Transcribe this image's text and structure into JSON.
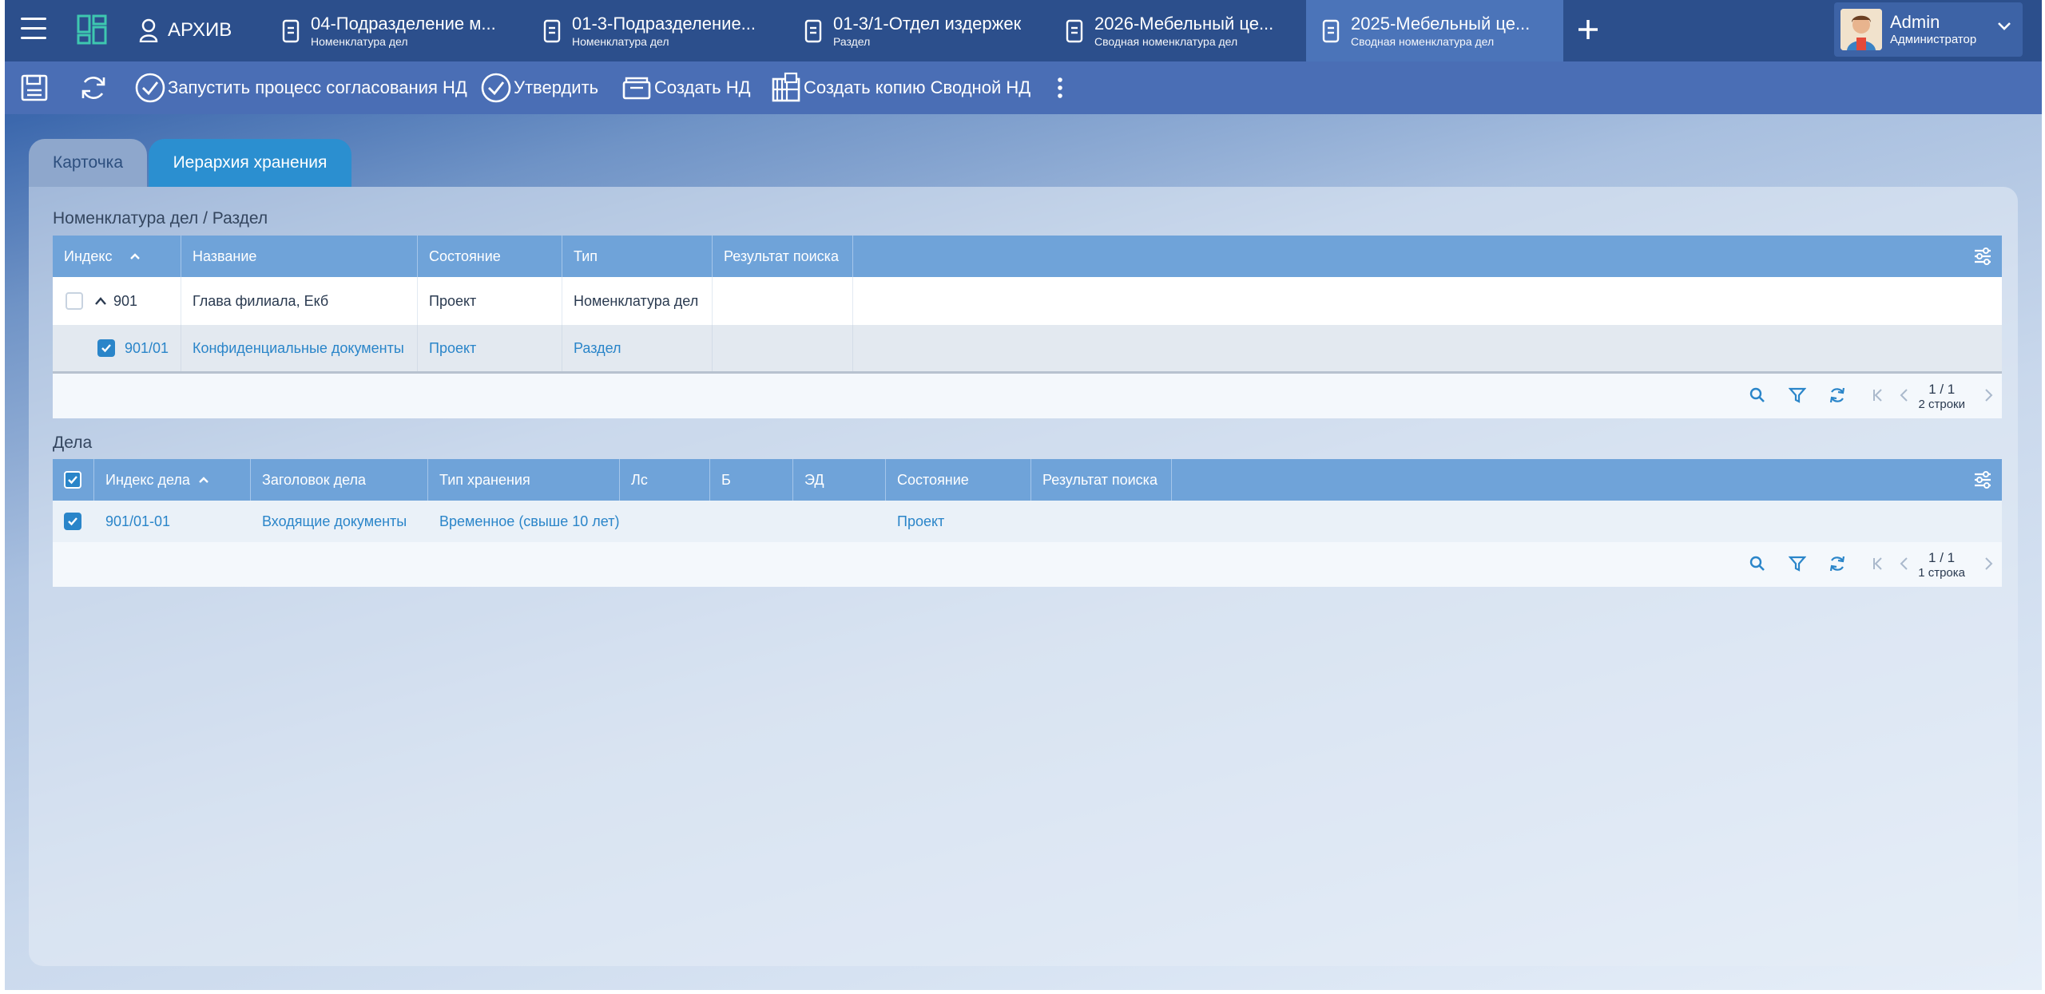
{
  "topbar": {
    "archive_label": "АРХИВ",
    "tabs": [
      {
        "title": "04-Подразделение м...",
        "subtitle": "Номенклатура дел"
      },
      {
        "title": "01-3-Подразделение...",
        "subtitle": "Номенклатура дел"
      },
      {
        "title": "01-3/1-Отдел издержек",
        "subtitle": "Раздел"
      },
      {
        "title": "2026-Мебельный це...",
        "subtitle": "Сводная номенклатура дел"
      },
      {
        "title": "2025-Мебельный це...",
        "subtitle": "Сводная номенклатура дел"
      }
    ],
    "active_tab": 4,
    "user": {
      "name": "Admin",
      "role": "Администратор"
    }
  },
  "toolbar": {
    "start_approval": "Запустить процесс согласования НД",
    "approve": "Утвердить",
    "create_nd": "Создать НД",
    "create_copy": "Создать копию Сводной НД"
  },
  "inner_tabs": {
    "card": "Карточка",
    "hierarchy": "Иерархия хранения"
  },
  "nomenclature": {
    "title": "Номенклатура дел / Раздел",
    "columns": [
      "Индекс",
      "Название",
      "Состояние",
      "Тип",
      "Результат поиска"
    ],
    "rows": [
      {
        "index": "901",
        "name": "Глава филиала, Екб",
        "state": "Проект",
        "type": "Номенклатура дел",
        "result": "",
        "checked": false
      },
      {
        "index": "901/01",
        "name": "Конфиденциальные документы",
        "state": "Проект",
        "type": "Раздел",
        "result": "",
        "checked": true
      }
    ],
    "pagination": {
      "page": "1 / 1",
      "rows": "2 строки"
    }
  },
  "cases": {
    "title": "Дела",
    "columns": [
      "Индекс дела",
      "Заголовок дела",
      "Тип хранения",
      "Лс",
      "Б",
      "ЭД",
      "Состояние",
      "Результат поиска"
    ],
    "rows": [
      {
        "index": "901/01-01",
        "title": "Входящие документы",
        "storage": "Временное (свыше 10 лет)",
        "ls": "",
        "b": "",
        "ed": "",
        "state": "Проект",
        "result": "",
        "checked": true
      }
    ],
    "pagination": {
      "page": "1 / 1",
      "rows": "1 строка"
    }
  },
  "colors": {
    "topbar": "#2c4f8c",
    "toolbar": "#4a6eb5",
    "header": "#6fa3d9",
    "accent": "#2a85c9"
  }
}
